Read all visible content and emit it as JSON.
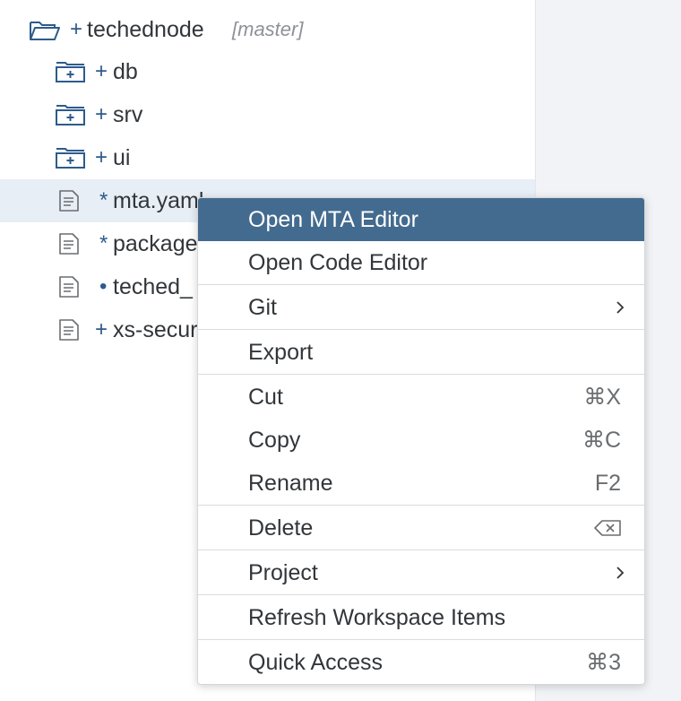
{
  "tree": {
    "root": {
      "prefix": "+",
      "name": "techednode",
      "branch": "[master]"
    },
    "items": [
      {
        "prefix": "+",
        "name": "db",
        "type": "folder"
      },
      {
        "prefix": "+",
        "name": "srv",
        "type": "folder"
      },
      {
        "prefix": "+",
        "name": "ui",
        "type": "folder"
      },
      {
        "prefix": "*",
        "name": "mta.yaml",
        "type": "file",
        "selected": true
      },
      {
        "prefix": "*",
        "name": "package.json",
        "type": "file"
      },
      {
        "prefix": "•",
        "name": "teched_",
        "type": "file"
      },
      {
        "prefix": "+",
        "name": "xs-security.json",
        "type": "file"
      }
    ]
  },
  "context_menu": {
    "items": [
      {
        "label": "Open MTA Editor",
        "highlighted": true
      },
      {
        "label": "Open Code Editor"
      },
      {
        "label": "Git",
        "submenu": true
      },
      {
        "label": "Export"
      },
      {
        "label": "Cut",
        "shortcut": "⌘X"
      },
      {
        "label": "Copy",
        "shortcut": "⌘C"
      },
      {
        "label": "Rename",
        "shortcut": "F2"
      },
      {
        "label": "Delete",
        "shortcut_icon": "backspace-icon"
      },
      {
        "label": "Project",
        "submenu": true
      },
      {
        "label": "Refresh Workspace Items"
      },
      {
        "label": "Quick Access",
        "shortcut": "⌘3"
      }
    ]
  },
  "colors": {
    "accent": "#2d5b8c",
    "menu_highlight": "#436b8f",
    "selected_row": "#e8eef6",
    "right_pane": "#f1f3f6",
    "text": "#32363a"
  }
}
